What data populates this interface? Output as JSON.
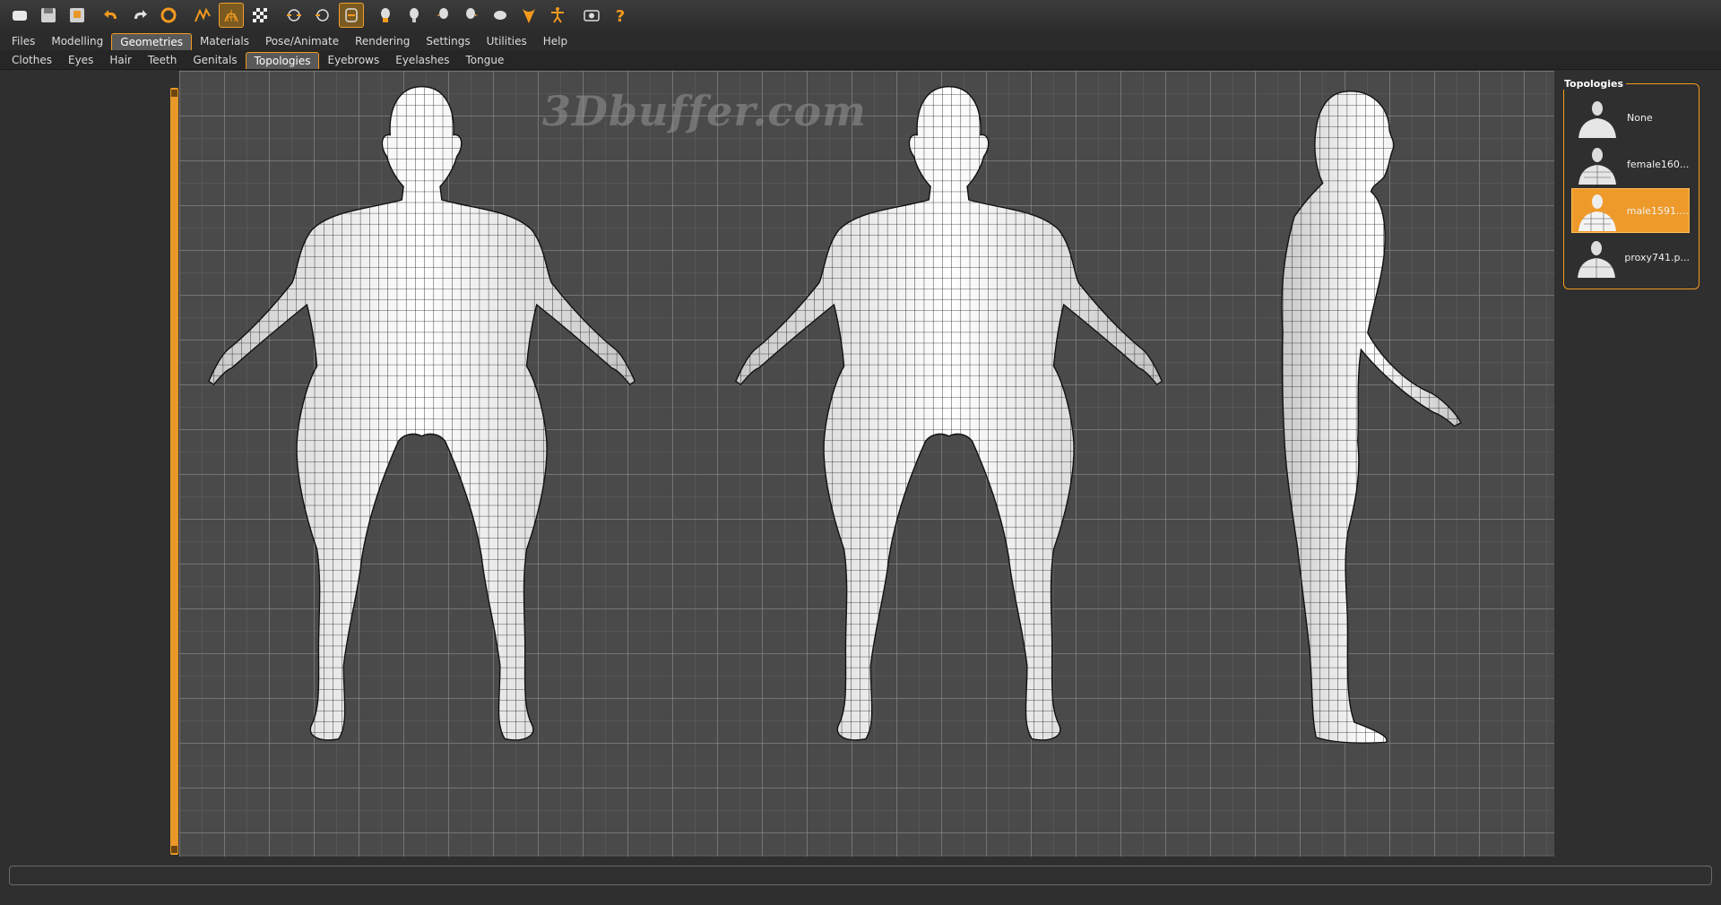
{
  "toolbar": {
    "buttons": [
      {
        "icon": "new-icon"
      },
      {
        "icon": "save-icon"
      },
      {
        "icon": "export-icon"
      },
      {
        "icon": "undo-icon"
      },
      {
        "icon": "redo-icon"
      },
      {
        "icon": "reset-icon"
      },
      {
        "icon": "smooth-icon"
      },
      {
        "icon": "wireframe-icon",
        "active": true
      },
      {
        "icon": "checker-icon"
      },
      {
        "icon": "front-view-icon"
      },
      {
        "icon": "back-view-icon"
      },
      {
        "icon": "top-view-icon"
      },
      {
        "icon": "head-front-icon"
      },
      {
        "icon": "head-back-icon"
      },
      {
        "icon": "head-left-icon"
      },
      {
        "icon": "head-right-icon"
      },
      {
        "icon": "head-top-icon"
      },
      {
        "icon": "pose-icon"
      },
      {
        "icon": "skeleton-icon"
      },
      {
        "icon": "screenshot-icon"
      },
      {
        "icon": "help-icon"
      }
    ]
  },
  "main_tabs": [
    "Files",
    "Modelling",
    "Geometries",
    "Materials",
    "Pose/Animate",
    "Rendering",
    "Settings",
    "Utilities",
    "Help"
  ],
  "main_tabs_active": "Geometries",
  "sub_tabs": [
    "Clothes",
    "Eyes",
    "Hair",
    "Teeth",
    "Genitals",
    "Topologies",
    "Eyebrows",
    "Eyelashes",
    "Tongue"
  ],
  "sub_tabs_active": "Topologies",
  "viewport": {
    "watermark": "3Dbuffer.com"
  },
  "topologies": {
    "title": "Topologies",
    "items": [
      {
        "label": "None",
        "selected": false
      },
      {
        "label": "female160...",
        "selected": false
      },
      {
        "label": "male1591....",
        "selected": true
      },
      {
        "label": "proxy741.p...",
        "selected": false
      }
    ]
  },
  "colors": {
    "accent": "#f29a1e",
    "viewport_bg": "#4a4a4a",
    "panel_bg": "#2f2f2f"
  }
}
